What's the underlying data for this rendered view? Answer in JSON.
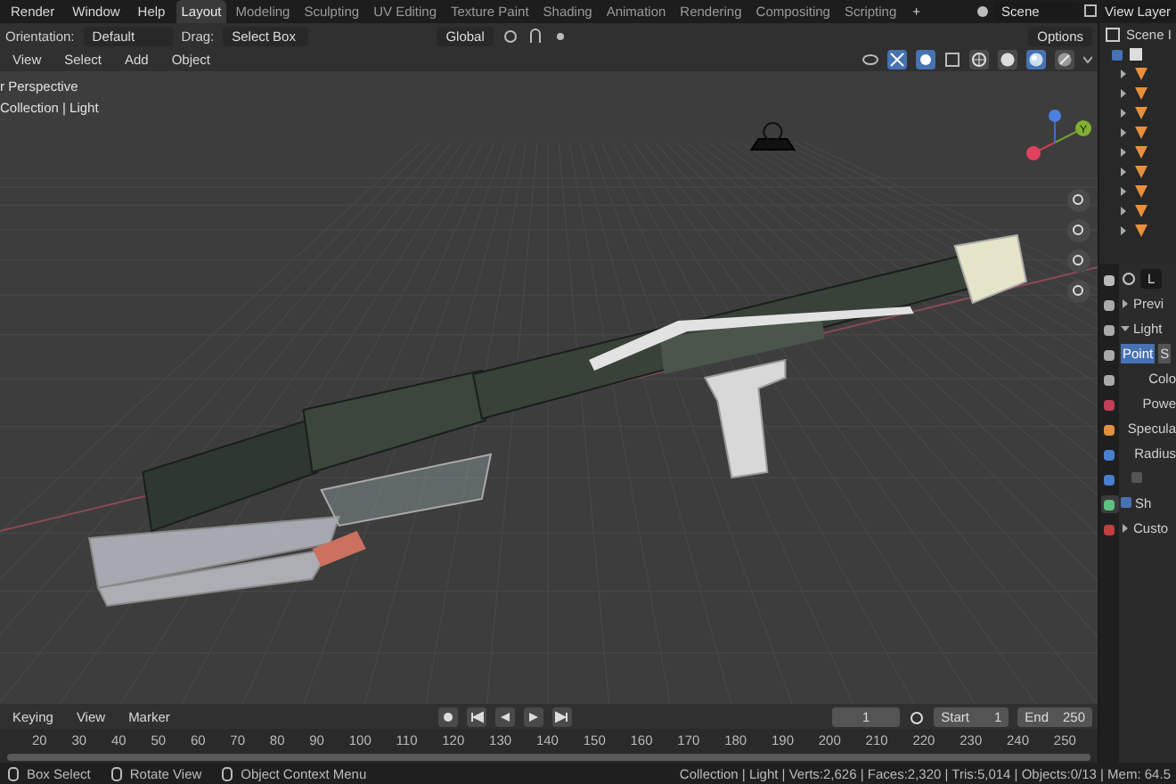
{
  "top_bar": {
    "menus": [
      "Render",
      "Window",
      "Help"
    ],
    "workspaces": [
      {
        "label": "Layout",
        "selected": true
      },
      {
        "label": "Modeling",
        "selected": false
      },
      {
        "label": "Sculpting",
        "selected": false
      },
      {
        "label": "UV Editing",
        "selected": false
      },
      {
        "label": "Texture Paint",
        "selected": false
      },
      {
        "label": "Shading",
        "selected": false
      },
      {
        "label": "Animation",
        "selected": false
      },
      {
        "label": "Rendering",
        "selected": false
      },
      {
        "label": "Compositing",
        "selected": false
      },
      {
        "label": "Scripting",
        "selected": false
      }
    ],
    "add_tab": "+",
    "scene": "Scene",
    "view_layer": "View Layer"
  },
  "viewport": {
    "header": {
      "orientation_label": "Orientation:",
      "orientation": "Default",
      "drag_label": "Drag:",
      "drag": "Select Box",
      "transform": "Global",
      "options": "Options",
      "menus": [
        "View",
        "Select",
        "Add",
        "Object"
      ],
      "shading": [
        {
          "kind": "wireframe",
          "selected": false
        },
        {
          "kind": "solid",
          "selected": false
        },
        {
          "kind": "material",
          "selected": true
        },
        {
          "kind": "rendered",
          "selected": false
        }
      ]
    },
    "overlay_lines": [
      "r Perspective",
      "Collection | Light"
    ],
    "gizmo_label": "Y"
  },
  "outliner": {
    "root": "Scene I",
    "collection_visible": true,
    "items": [
      {
        "expanded": false
      },
      {
        "expanded": false
      },
      {
        "expanded": false
      },
      {
        "expanded": false
      },
      {
        "expanded": false
      },
      {
        "expanded": false
      },
      {
        "expanded": false
      },
      {
        "expanded": false
      },
      {
        "expanded": false
      }
    ]
  },
  "properties": {
    "tabs": [
      {
        "kind": "tool",
        "selected": false
      },
      {
        "kind": "render",
        "selected": false
      },
      {
        "kind": "output",
        "selected": false
      },
      {
        "kind": "view",
        "selected": false
      },
      {
        "kind": "scene",
        "selected": false
      },
      {
        "kind": "world",
        "selected": false
      },
      {
        "kind": "object",
        "selected": false
      },
      {
        "kind": "constraint",
        "selected": false
      },
      {
        "kind": "physics",
        "selected": false
      },
      {
        "kind": "data",
        "selected": true
      },
      {
        "kind": "texture",
        "selected": false
      }
    ],
    "data_name": "L",
    "rows": [
      {
        "kind": "panel",
        "label": "Previ",
        "expanded": false
      },
      {
        "kind": "panel",
        "label": "Light",
        "expanded": true
      },
      {
        "kind": "segments",
        "items": [
          {
            "label": "Point",
            "selected": true
          },
          {
            "label": "S",
            "selected": false
          }
        ]
      },
      {
        "kind": "field",
        "label": "Colo"
      },
      {
        "kind": "field",
        "label": "Powe"
      },
      {
        "kind": "field",
        "label": "Specula"
      },
      {
        "kind": "field",
        "label": "Radius"
      },
      {
        "kind": "subpanel",
        "checked": false
      },
      {
        "kind": "checkpanel",
        "label": "Sh",
        "checked": true
      },
      {
        "kind": "panel",
        "label": "Custo",
        "expanded": false
      }
    ]
  },
  "timeline": {
    "menus": [
      "Keying",
      "View",
      "Marker"
    ],
    "current_frame": "1",
    "start_label": "Start",
    "start": "1",
    "end_label": "End",
    "end": "250",
    "ticks": [
      "20",
      "30",
      "40",
      "50",
      "60",
      "70",
      "80",
      "90",
      "100",
      "110",
      "120",
      "130",
      "140",
      "150",
      "160",
      "170",
      "180",
      "190",
      "200",
      "210",
      "220",
      "230",
      "240",
      "250"
    ]
  },
  "status_bar": {
    "hints": [
      "Box Select",
      "Rotate View",
      "Object Context Menu"
    ],
    "stats": "Collection | Light | Verts:2,626 | Faces:2,320 | Tris:5,014 | Objects:0/13 | Mem: 64.5"
  }
}
